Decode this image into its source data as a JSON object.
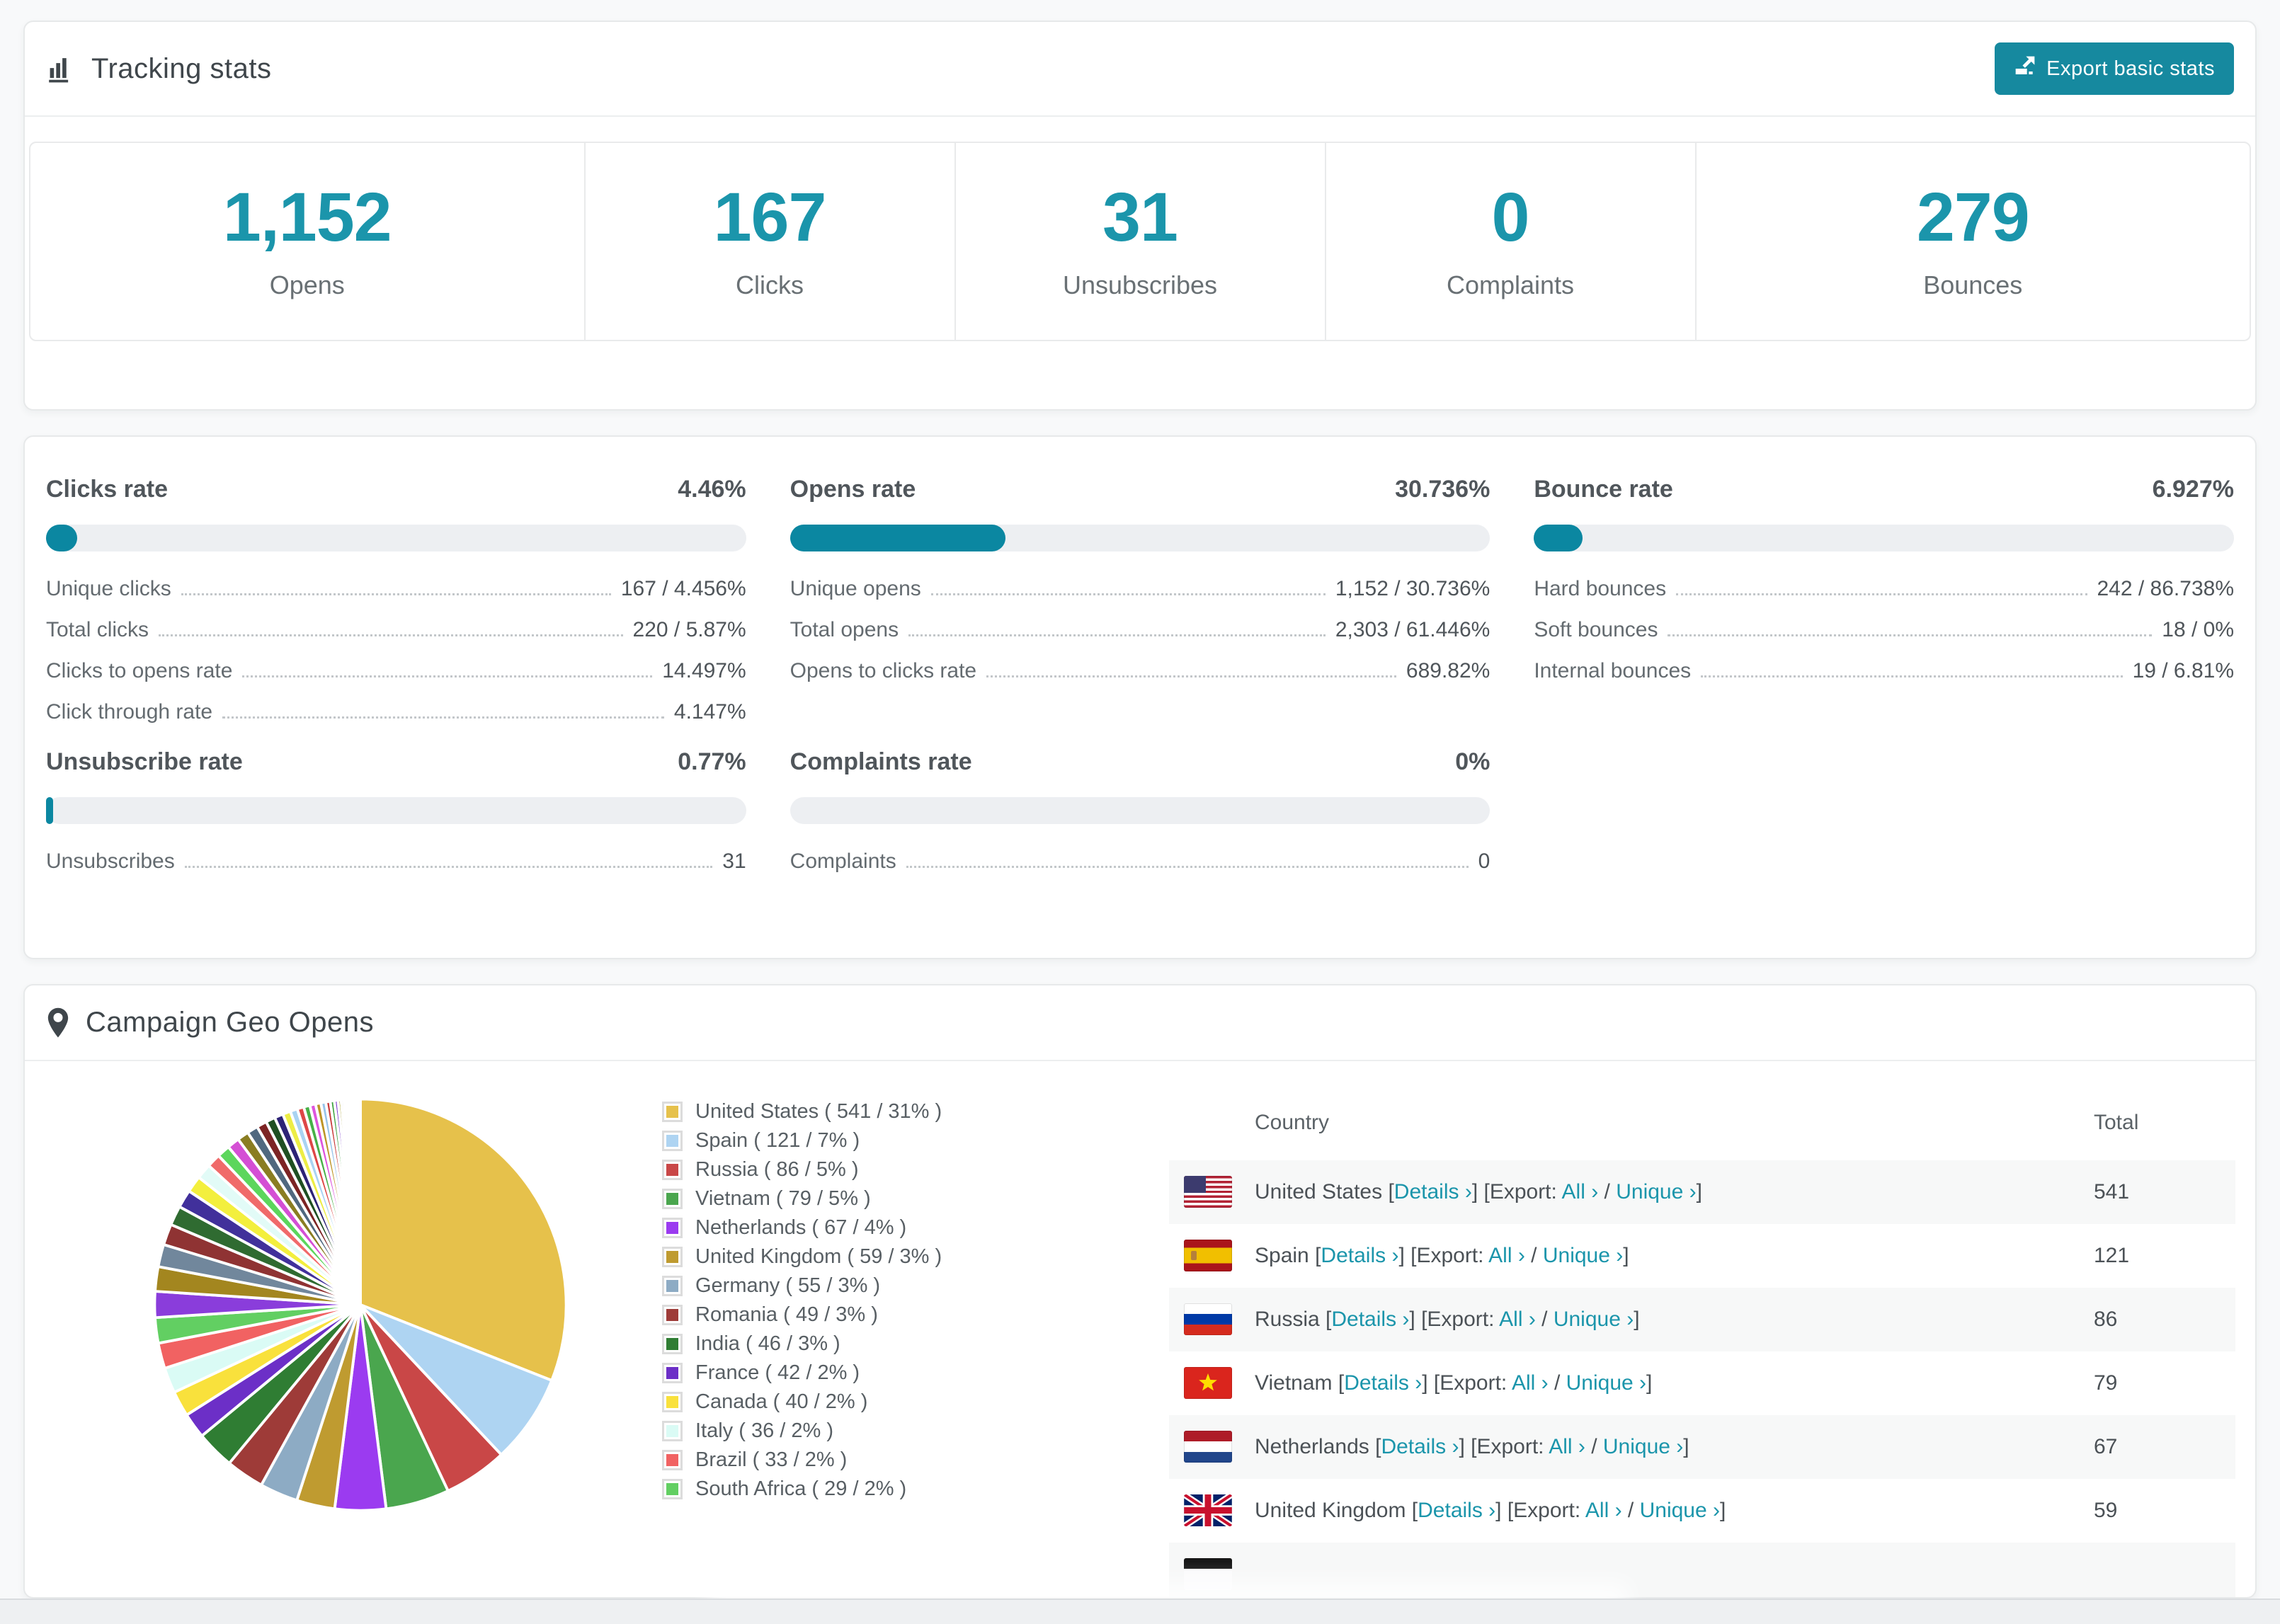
{
  "accent": "#1b95ab",
  "tracking": {
    "title": "Tracking stats",
    "export_button": {
      "label": "Export basic stats",
      "icon": "export-icon"
    },
    "stats": [
      {
        "value": "1,152",
        "label": "Opens"
      },
      {
        "value": "167",
        "label": "Clicks"
      },
      {
        "value": "31",
        "label": "Unsubscribes"
      },
      {
        "value": "0",
        "label": "Complaints"
      },
      {
        "value": "279",
        "label": "Bounces"
      }
    ]
  },
  "rates": [
    {
      "title": "Clicks rate",
      "value": "4.46%",
      "pct": 4.46,
      "rows": [
        {
          "label": "Unique clicks",
          "value": "167 / 4.456%"
        },
        {
          "label": "Total clicks",
          "value": "220 / 5.87%"
        },
        {
          "label": "Clicks to opens rate",
          "value": "14.497%"
        },
        {
          "label": "Click through rate",
          "value": "4.147%"
        }
      ]
    },
    {
      "title": "Opens rate",
      "value": "30.736%",
      "pct": 30.736,
      "rows": [
        {
          "label": "Unique opens",
          "value": "1,152 / 30.736%"
        },
        {
          "label": "Total opens",
          "value": "2,303 / 61.446%"
        },
        {
          "label": "Opens to clicks rate",
          "value": "689.82%"
        }
      ]
    },
    {
      "title": "Bounce rate",
      "value": "6.927%",
      "pct": 6.927,
      "rows": [
        {
          "label": "Hard bounces",
          "value": "242 / 86.738%"
        },
        {
          "label": "Soft bounces",
          "value": "18 / 0%"
        },
        {
          "label": "Internal bounces",
          "value": "19 / 6.81%"
        }
      ]
    },
    {
      "title": "Unsubscribe rate",
      "value": "0.77%",
      "pct": 0.77,
      "rows": [
        {
          "label": "Unsubscribes",
          "value": "31"
        }
      ]
    },
    {
      "title": "Complaints rate",
      "value": "0%",
      "pct": 0,
      "rows": [
        {
          "label": "Complaints",
          "value": "0"
        }
      ]
    }
  ],
  "geo": {
    "title": "Campaign Geo Opens",
    "table": {
      "headers": [
        "Country",
        "Total"
      ],
      "row_links": {
        "details": "Details ›",
        "export_label": "[Export:",
        "all": "All ›",
        "slash": "/",
        "unique": "Unique ›"
      },
      "rows": [
        {
          "country": "United States",
          "flag": "us",
          "total": "541"
        },
        {
          "country": "Spain",
          "flag": "es",
          "total": "121"
        },
        {
          "country": "Russia",
          "flag": "ru",
          "total": "86"
        },
        {
          "country": "Vietnam",
          "flag": "vn",
          "total": "79"
        },
        {
          "country": "Netherlands",
          "flag": "nl",
          "total": "67"
        },
        {
          "country": "United Kingdom",
          "flag": "gb",
          "total": "59"
        }
      ],
      "partial_row_visible": true
    }
  },
  "chart_data": {
    "type": "pie",
    "title": "Campaign Geo Opens",
    "legend_position": "right",
    "series": [
      {
        "name": "United States",
        "value": 541,
        "pct": 31,
        "color": "#e6c14b"
      },
      {
        "name": "Spain",
        "value": 121,
        "pct": 7,
        "color": "#aed4f2"
      },
      {
        "name": "Russia",
        "value": 86,
        "pct": 5,
        "color": "#c94747"
      },
      {
        "name": "Vietnam",
        "value": 79,
        "pct": 5,
        "color": "#4aa64e"
      },
      {
        "name": "Netherlands",
        "value": 67,
        "pct": 4,
        "color": "#9b3bf0"
      },
      {
        "name": "United Kingdom",
        "value": 59,
        "pct": 3,
        "color": "#bf9b30"
      },
      {
        "name": "Germany",
        "value": 55,
        "pct": 3,
        "color": "#8dabc4"
      },
      {
        "name": "Romania",
        "value": 49,
        "pct": 3,
        "color": "#9e3b38"
      },
      {
        "name": "India",
        "value": 46,
        "pct": 3,
        "color": "#2f7d33"
      },
      {
        "name": "France",
        "value": 42,
        "pct": 2,
        "color": "#6c2fc7"
      },
      {
        "name": "Canada",
        "value": 40,
        "pct": 2,
        "color": "#f9e13c"
      },
      {
        "name": "Italy",
        "value": 36,
        "pct": 2,
        "color": "#dafbf5"
      },
      {
        "name": "Brazil",
        "value": 33,
        "pct": 2,
        "color": "#f16262"
      },
      {
        "name": "South Africa",
        "value": 29,
        "pct": 2,
        "color": "#62cf62"
      }
    ],
    "other_slices_total_pct": 26,
    "other_slice_weights": [
      1.8,
      1.7,
      1.55,
      1.45,
      1.35,
      1.25,
      1.15,
      1.05,
      0.95,
      0.9,
      0.85,
      0.8,
      0.75,
      0.7,
      0.65,
      0.6,
      0.55,
      0.5,
      0.46,
      0.43,
      0.4,
      0.37,
      0.34,
      0.31,
      0.28,
      0.25,
      0.22,
      0.2,
      0.18,
      0.16,
      0.14,
      0.12,
      0.1,
      0.09,
      0.08,
      0.07,
      0.06,
      0.05,
      0.04,
      0.03
    ],
    "other_slice_colors": [
      "#8a3ddb",
      "#a3861f",
      "#71879c",
      "#8f3333",
      "#2f6b31",
      "#41309b",
      "#f3ef3d",
      "#e2fbf7",
      "#f06a6a",
      "#5cd65c",
      "#d44fd4",
      "#8a7d22",
      "#50687f",
      "#7c2424",
      "#1f4f22",
      "#2d2376",
      "#eded45",
      "#a9d3f2",
      "#dd4747",
      "#47b047",
      "#dd55dd",
      "#bd9426",
      "#97c4ea",
      "#c93a3a",
      "#3aa13d",
      "#7a35cf",
      "#aaa02b",
      "#d7d9f2",
      "#ef8686",
      "#86e086",
      "#e08ae0",
      "#9d9d35",
      "#7595b5",
      "#8f3a3a",
      "#2f5f33",
      "#4f40a5",
      "#e6e670",
      "#c2e2f2",
      "#eaa4a4",
      "#a4e4a4"
    ]
  }
}
